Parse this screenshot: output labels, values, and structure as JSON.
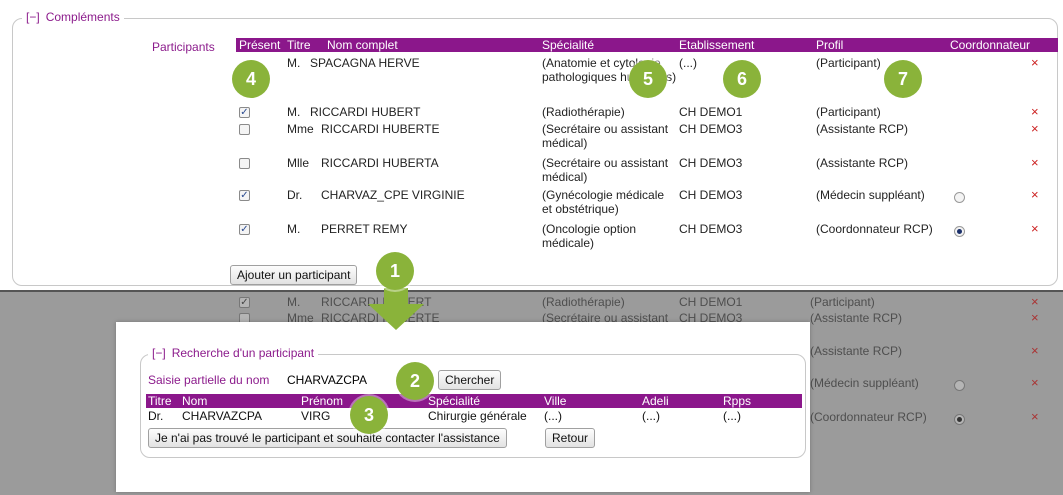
{
  "complements": {
    "toggle": "[−]",
    "legend": "Compléments",
    "participants_label": "Participants",
    "columns": {
      "present": "Présent",
      "titre": "Titre",
      "nom": "Nom complet",
      "specialite": "Spécialité",
      "etablissement": "Etablissement",
      "profil": "Profil",
      "coordonnateur": "Coordonnateur"
    },
    "rows": [
      {
        "checked": false,
        "titre": "M.",
        "nom": "SPACAGNA HERVE",
        "spec": "(Anatomie et cytologie pathologiques humaines)",
        "etab": "(...)",
        "profil": "(Participant)",
        "radio": null
      },
      {
        "checked": true,
        "titre": "M.",
        "nom": "RICCARDI HUBERT",
        "spec": "(Radiothérapie)",
        "etab": "CH DEMO1",
        "profil": "(Participant)",
        "radio": null
      },
      {
        "checked": false,
        "titre": "Mme",
        "nom": "RICCARDI HUBERTE",
        "spec": "(Secrétaire ou assistant médical)",
        "etab": "CH DEMO3",
        "profil": "(Assistante RCP)",
        "radio": null
      },
      {
        "checked": false,
        "titre": "Mlle",
        "nom": "RICCARDI HUBERTA",
        "spec": "(Secrétaire ou assistant médical)",
        "etab": "CH DEMO3",
        "profil": "(Assistante RCP)",
        "radio": null
      },
      {
        "checked": true,
        "titre": "Dr.",
        "nom": "CHARVAZ_CPE VIRGINIE",
        "spec": "(Gynécologie médicale et obstétrique)",
        "etab": "CH DEMO3",
        "profil": "(Médecin suppléant)",
        "radio": false
      },
      {
        "checked": true,
        "titre": "M.",
        "nom": "PERRET REMY",
        "spec": "(Oncologie option médicale)",
        "etab": "CH DEMO3",
        "profil": "(Coordonnateur RCP)",
        "radio": true
      }
    ],
    "delete_symbol": "×",
    "check_symbol": "✓",
    "add_button": "Ajouter un participant"
  },
  "background": {
    "rows": [
      {
        "titre": "M.",
        "nom": "RICCARDI HUBERT",
        "spec": "(Radiothérapie)",
        "etab": "CH DEMO1",
        "profil": "(Participant)"
      },
      {
        "titre": "Mme",
        "nom": "RICCARDI HUBERTE",
        "spec": "(Secrétaire ou assistant",
        "etab": "CH DEMO3",
        "profil": "(Assistante RCP)"
      },
      {
        "titre": "",
        "nom": "",
        "spec": "",
        "etab": "",
        "profil": "(Assistante RCP)"
      },
      {
        "titre": "",
        "nom": "",
        "spec": "",
        "etab": "",
        "profil": "(Médecin suppléant)"
      },
      {
        "titre": "",
        "nom": "",
        "spec": "",
        "etab": "",
        "profil": "(Coordonnateur RCP)"
      }
    ]
  },
  "search": {
    "toggle": "[−]",
    "legend": "Recherche d'un participant",
    "label": "Saisie partielle du nom",
    "value": "CHARVAZCPA",
    "search_button": "Chercher",
    "columns": {
      "titre": "Titre",
      "nom": "Nom",
      "prenom": "Prénom",
      "specialite": "Spécialité",
      "ville": "Ville",
      "adeli": "Adeli",
      "rpps": "Rpps"
    },
    "result": {
      "titre": "Dr.",
      "nom": "CHARVAZCPA",
      "prenom": "VIRG",
      "specialite": "Chirurgie générale",
      "ville": "(...)",
      "adeli": "(...)",
      "rpps": "(...)"
    },
    "not_found_button": "Je n'ai pas trouvé le participant et souhaite contacter l'assistance",
    "back_button": "Retour"
  },
  "markers": [
    "1",
    "2",
    "3",
    "4",
    "5",
    "6",
    "7"
  ],
  "colors": {
    "accent": "#8b178b",
    "marker": "#8ab33a",
    "delete": "#cc2222",
    "overlay": "#9b9b9b"
  }
}
